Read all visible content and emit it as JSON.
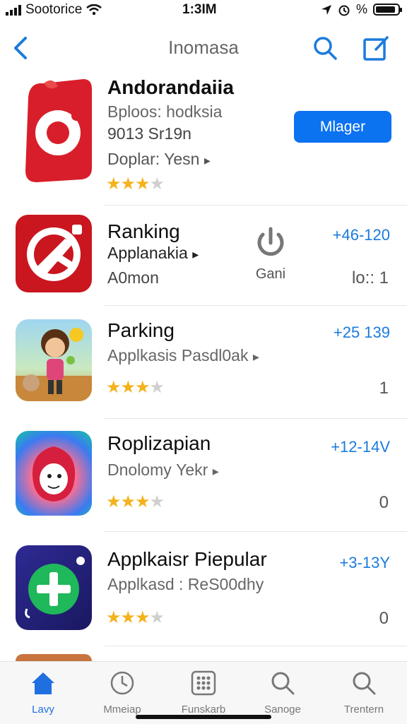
{
  "status": {
    "carrier": "Sootorice",
    "time": "1:3IM",
    "battery_pct": "%"
  },
  "nav": {
    "title": "Inomasa"
  },
  "apps": [
    {
      "name": "Andorandaiia",
      "subtitle": "Bploos: hodksia",
      "detail": "9013 Sr19n",
      "developer": "Doplar: Yesn",
      "rating": 3.5,
      "action": "Mlager"
    },
    {
      "name": "Ranking",
      "subtitle": "Applanakia",
      "detail": "A0mon",
      "action_label": "Gani",
      "price": "+46-120",
      "count": "lo:: 1"
    },
    {
      "name": "Parking",
      "subtitle": "Applkasis Pasdl0ak",
      "price": "+25 139",
      "count": "1",
      "rating": 3.5
    },
    {
      "name": "Roplizapian",
      "subtitle": "Dnolomy Yekr",
      "price": "+12-14V",
      "count": "0",
      "rating": 3.5
    },
    {
      "name": "Applkaisr Piepular",
      "subtitle": "Applkasd : ReS00dhy",
      "price": "+3-13Y",
      "count": "0",
      "rating": 3.5
    }
  ],
  "tabs": [
    {
      "label": "Lavy",
      "icon": "home-icon"
    },
    {
      "label": "Mmeiap",
      "icon": "clock-icon"
    },
    {
      "label": "Funskarb",
      "icon": "grid-icon"
    },
    {
      "label": "Sanoge",
      "icon": "search-icon"
    },
    {
      "label": "Trentern",
      "icon": "search-icon"
    }
  ],
  "colors": {
    "accent": "#1a7bdc",
    "button": "#0b72f0",
    "star": "#f4b21c"
  }
}
